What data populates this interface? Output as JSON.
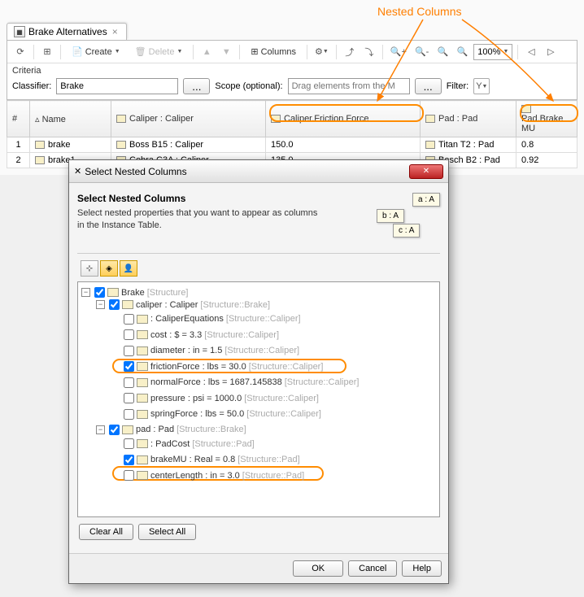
{
  "annotation": "Nested Columns",
  "tab": {
    "title": "Brake Alternatives",
    "close": "×"
  },
  "toolbar": {
    "create": "Create",
    "delete": "Delete",
    "columns": "Columns",
    "zoom": "100%"
  },
  "criteria": {
    "section": "Criteria",
    "classifier_label": "Classifier:",
    "classifier_value": "Brake",
    "scope_label": "Scope (optional):",
    "scope_placeholder": "Drag elements from the M",
    "filter_label": "Filter:",
    "browse": "..."
  },
  "table": {
    "headers": [
      "#",
      "Name",
      "Caliper : Caliper",
      "Caliper.Friction Force",
      "Pad : Pad",
      "Pad.Brake MU"
    ],
    "rows": [
      {
        "n": "1",
        "name": "brake",
        "caliper": "Boss B15 : Caliper",
        "ff": "150.0",
        "pad": "Titan T2 : Pad",
        "mu": "0.8"
      },
      {
        "n": "2",
        "name": "brake1",
        "caliper": "Cobra C3A : Caliper",
        "ff": "135.0",
        "pad": "Bosch B2 : Pad",
        "mu": "0.92"
      }
    ]
  },
  "dialog": {
    "title": "Select Nested Columns",
    "heading": "Select Nested Columns",
    "sub": "Select nested properties that you want to appear as columns in the Instance Table.",
    "illus": {
      "a": "a : A",
      "b": "b : A",
      "c": "c : A"
    },
    "tree": {
      "root": "Brake",
      "root_meta": "[Structure]",
      "caliper": "caliper : Caliper",
      "caliper_meta": "[Structure::Brake]",
      "cal_eq": ": CaliperEquations",
      "cal_eq_meta": "[Structure::Caliper]",
      "cost": "cost : $ = 3.3",
      "cost_meta": "[Structure::Caliper]",
      "diameter": "diameter : in  = 1.5",
      "diameter_meta": "[Structure::Caliper]",
      "friction": "frictionForce : lbs = 30.0",
      "friction_meta": "[Structure::Caliper]",
      "normal": "normalForce : lbs = 1687.145838",
      "normal_meta": "[Structure::Caliper]",
      "pressure": "pressure : psi  = 1000.0",
      "pressure_meta": "[Structure::Caliper]",
      "spring": "springForce : lbs = 50.0",
      "spring_meta": "[Structure::Caliper]",
      "pad": "pad : Pad",
      "pad_meta": "[Structure::Brake]",
      "padcost": ": PadCost",
      "padcost_meta": "[Structure::Pad]",
      "brakemu": "brakeMU : Real  = 0.8",
      "brakemu_meta": "[Structure::Pad]",
      "centerlen": "centerLength : in  = 3.0",
      "centerlen_meta": "[Structure::Pad]"
    },
    "clear_all": "Clear All",
    "select_all": "Select All",
    "ok": "OK",
    "cancel": "Cancel",
    "help": "Help"
  }
}
